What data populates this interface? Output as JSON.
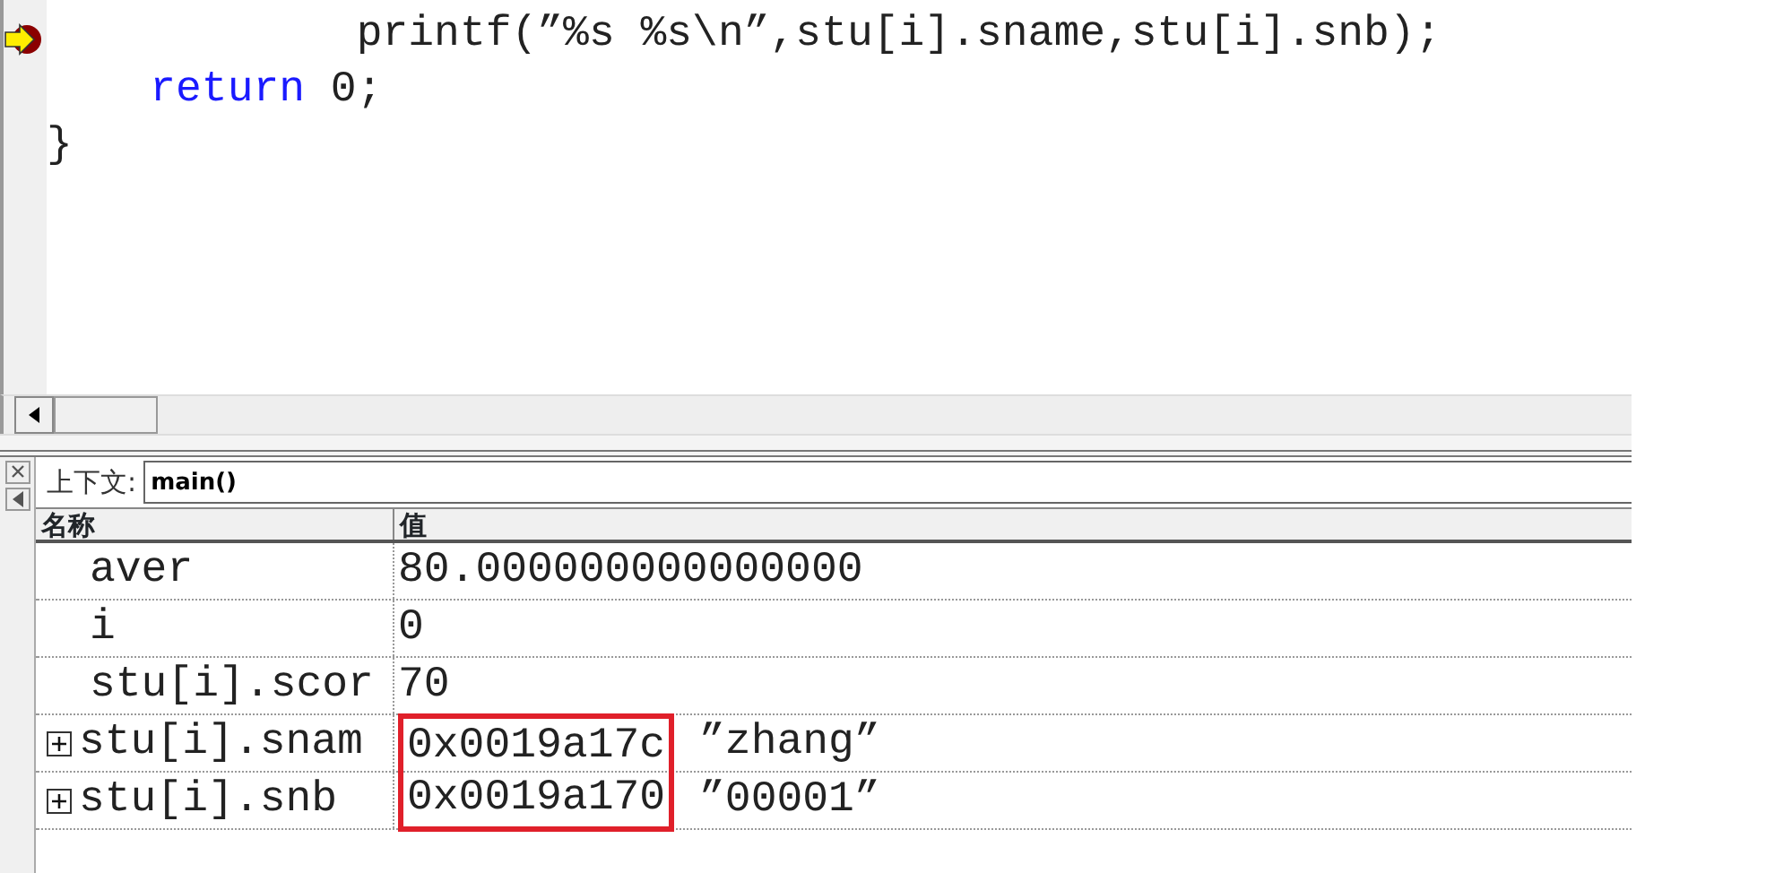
{
  "editor": {
    "lines": [
      {
        "current": true,
        "tokens": [
          {
            "kind": "plain",
            "text": "            printf(”%s %s\\n”,stu[i].sname,stu[i].snb);"
          }
        ]
      },
      {
        "current": false,
        "tokens": [
          {
            "kind": "keyword",
            "text": "    return"
          },
          {
            "kind": "plain",
            "text": " 0;"
          }
        ]
      },
      {
        "current": false,
        "tokens": [
          {
            "kind": "plain",
            "text": "}"
          }
        ]
      }
    ]
  },
  "watch": {
    "context_label": "上下文:",
    "context_value": "main()",
    "columns": [
      "名称",
      "值"
    ],
    "rows": [
      {
        "name": "aver",
        "value": "80.000000000000000",
        "expandable": false,
        "highlighted": false
      },
      {
        "name": "i",
        "value": "0",
        "expandable": false,
        "highlighted": false
      },
      {
        "name": "stu[i].scor",
        "value": "70",
        "expandable": false,
        "highlighted": false
      },
      {
        "name": "stu[i].snam",
        "value": "0x0019a17c",
        "string": "”zhang”",
        "expandable": true,
        "highlighted": true
      },
      {
        "name": "stu[i].snb",
        "value": "0x0019a170",
        "string": "”00001”",
        "expandable": true,
        "highlighted": true
      }
    ]
  }
}
